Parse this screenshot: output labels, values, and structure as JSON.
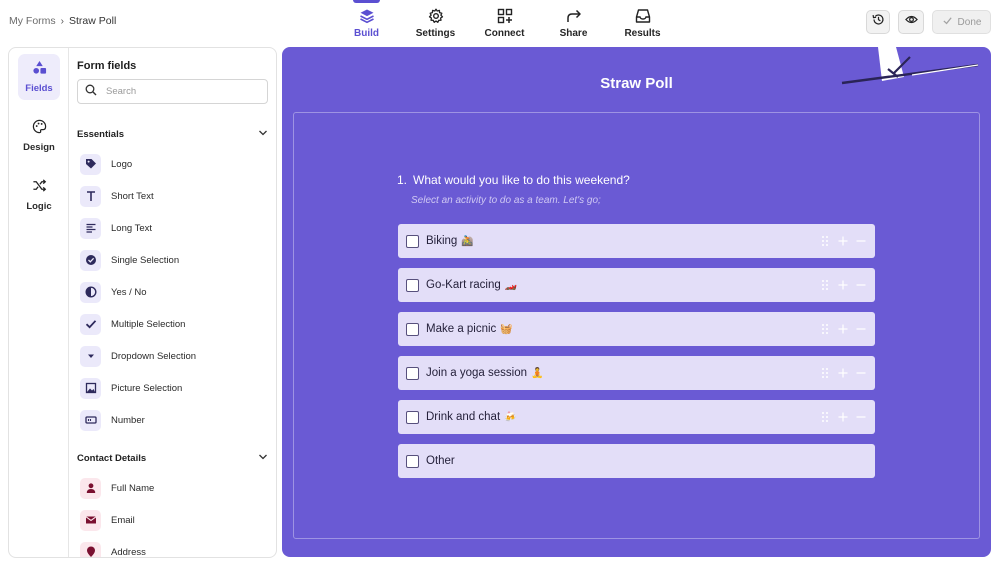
{
  "breadcrumb": {
    "parent": "My Forms",
    "separator": "›",
    "current": "Straw Poll"
  },
  "nav": {
    "tabs": [
      {
        "label": "Build",
        "icon": "layers-icon",
        "active": true
      },
      {
        "label": "Settings",
        "icon": "gear-icon",
        "active": false
      },
      {
        "label": "Connect",
        "icon": "connect-icon",
        "active": false
      },
      {
        "label": "Share",
        "icon": "share-arrow-icon",
        "active": false
      },
      {
        "label": "Results",
        "icon": "inbox-icon",
        "active": false
      }
    ]
  },
  "toolbar": {
    "history_icon": "history-icon",
    "preview_icon": "eye-icon",
    "done_label": "Done"
  },
  "rail": {
    "fields": "Fields",
    "design": "Design",
    "logic": "Logic"
  },
  "panel": {
    "title": "Form fields",
    "search_placeholder": "Search",
    "essentials": {
      "label": "Essentials",
      "items": [
        {
          "label": "Logo",
          "icon": "tag-icon"
        },
        {
          "label": "Short Text",
          "icon": "text-t-icon"
        },
        {
          "label": "Long Text",
          "icon": "paragraph-icon"
        },
        {
          "label": "Single Selection",
          "icon": "check-circle-icon"
        },
        {
          "label": "Yes / No",
          "icon": "yes-no-icon"
        },
        {
          "label": "Multiple Selection",
          "icon": "checkmark-icon"
        },
        {
          "label": "Dropdown Selection",
          "icon": "dropdown-icon"
        },
        {
          "label": "Picture Selection",
          "icon": "picture-icon"
        },
        {
          "label": "Number",
          "icon": "number-icon"
        }
      ]
    },
    "contact": {
      "label": "Contact Details",
      "items": [
        {
          "label": "Full Name",
          "icon": "person-icon"
        },
        {
          "label": "Email",
          "icon": "envelope-icon"
        },
        {
          "label": "Address",
          "icon": "location-icon"
        }
      ]
    }
  },
  "form": {
    "title": "Straw Poll",
    "question_number": "1.",
    "question": "What would you like to do this weekend?",
    "hint": "Select an activity to do as a team. Let's go;",
    "options": [
      {
        "text": "Biking",
        "emoji": "🚵"
      },
      {
        "text": "Go-Kart racing",
        "emoji": "🏎️"
      },
      {
        "text": "Make a picnic",
        "emoji": "🧺"
      },
      {
        "text": "Join a yoga session",
        "emoji": "🧘"
      },
      {
        "text": "Drink and chat",
        "emoji": "🍻"
      },
      {
        "text": "Other",
        "emoji": ""
      }
    ]
  },
  "colors": {
    "accent": "#5b4fd1",
    "canvas": "#6a5ad4",
    "option_bg": "#e3def8",
    "contact_icon": "#7a1030"
  }
}
